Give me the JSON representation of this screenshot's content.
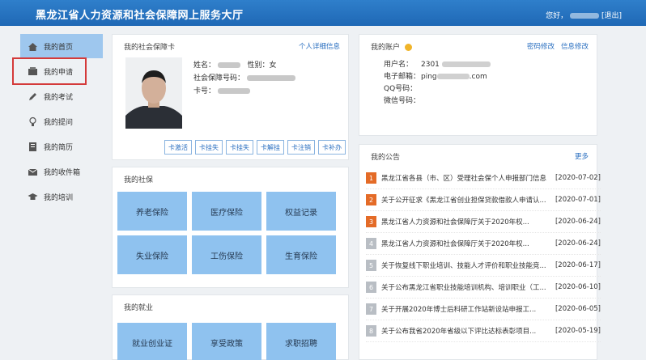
{
  "header": {
    "title": "黑龙江省人力资源和社会保障网上服务大厅",
    "user_label": "您好，",
    "logout": "[退出]"
  },
  "sidebar": {
    "items": [
      {
        "label": "我的首页",
        "icon": "home-icon"
      },
      {
        "label": "我的申请",
        "icon": "inbox-icon"
      },
      {
        "label": "我的考试",
        "icon": "pencil-icon"
      },
      {
        "label": "我的提问",
        "icon": "lightbulb-icon"
      },
      {
        "label": "我的简历",
        "icon": "resume-icon"
      },
      {
        "label": "我的收件箱",
        "icon": "mailbox-icon"
      },
      {
        "label": "我的培训",
        "icon": "graduation-cap-icon"
      }
    ]
  },
  "social_card": {
    "title": "我的社会保障卡",
    "link": "个人详细信息",
    "name_label": "姓名：",
    "gender_label": "性别：",
    "gender_value": "女",
    "card_no_label": "社会保障号码：",
    "number_label": "卡号：",
    "buttons": [
      "卡激活",
      "卡挂失",
      "卡挂失",
      "卡解挂",
      "卡注销",
      "卡补办"
    ]
  },
  "insurance": {
    "title": "我的社保",
    "tiles": [
      "养老保险",
      "医疗保险",
      "权益记录",
      "失业保险",
      "工伤保险",
      "生育保险"
    ]
  },
  "employment": {
    "title": "我的就业",
    "tiles": [
      "就业创业证",
      "享受政策",
      "求职招聘"
    ]
  },
  "account": {
    "title": "我的账户",
    "link_pwd": "密码修改",
    "link_info": "信息修改",
    "username_label": "用户名：",
    "username_value": "2301",
    "email_label": "电子邮箱：",
    "email_prefix": "ping",
    "email_suffix": ".com",
    "qq_label": "QQ号码：",
    "wechat_label": "微信号码："
  },
  "notices": {
    "title": "我的公告",
    "more": "更多",
    "items": [
      {
        "n": "1",
        "text": "黑龙江省各县（市、区）受理社会保个人申报部门信息",
        "date": "[2020-07-02]",
        "hot": true
      },
      {
        "n": "2",
        "text": "关于公开征求《黑龙江省创业担保贷款借款人申请认...",
        "date": "[2020-07-01]",
        "hot": true
      },
      {
        "n": "3",
        "text": "黑龙江省人力资源和社会保障厅关于2020年权...",
        "date": "[2020-06-24]",
        "hot": true
      },
      {
        "n": "4",
        "text": "黑龙江省人力资源和社会保障厅关于2020年权...",
        "date": "[2020-06-24]",
        "hot": false
      },
      {
        "n": "5",
        "text": "关于恢复线下职业培训、技能人才评价和职业技能竞...",
        "date": "[2020-06-17]",
        "hot": false
      },
      {
        "n": "6",
        "text": "关于公布黑龙江省职业技能培训机构、培训职业（工...",
        "date": "[2020-06-10]",
        "hot": false
      },
      {
        "n": "7",
        "text": "关于开展2020年博士后科研工作站新设站申报工...",
        "date": "[2020-06-05]",
        "hot": false
      },
      {
        "n": "8",
        "text": "关于公布我省2020年省级以下评比达标表彰项目...",
        "date": "[2020-05-19]",
        "hot": false
      }
    ]
  },
  "colors": {
    "header": "#1f68b5",
    "tile": "#8fc2ef",
    "active_nav": "#9ec7ee",
    "hot_badge": "#e46b27",
    "highlight_box": "#d43a3a"
  }
}
